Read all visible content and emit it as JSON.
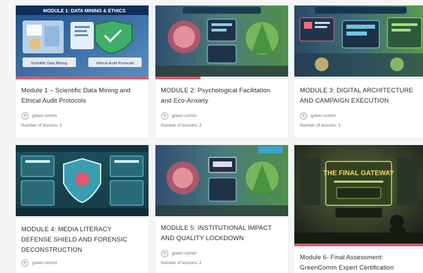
{
  "colors": {
    "accent": "#e2566a",
    "card_bg": "#ffffff",
    "page_bg": "#f4f5f7"
  },
  "courses": [
    {
      "thumb_caption": "MODULE 1: DATA MINING & ETHICS",
      "thumb_left_label": "Scientific Data Mining",
      "thumb_right_label": "Ethical Audit Protocols",
      "title": "Module 1 – Scientific Data Mining and Ethical Audit Protocols",
      "author": "green-comm",
      "lessons": "Number of lessons: 3",
      "progress": 1.0
    },
    {
      "title": "MODULE 2: Psychological Facilitation and Eco-Anxiety",
      "author": "green-comm",
      "lessons": "Number of lessons: 3",
      "progress": 0.34
    },
    {
      "title": "MODULE 3: DIGITAL ARCHITECTURE AND CAMPAIGN EXECUTION",
      "author": "green-comm",
      "lessons": "Number of lessons: 3",
      "progress": 0.0
    },
    {
      "title": "MODULE 4: MEDIA LITERACY DEFENSE SHIELD AND FORENSIC DECONSTRUCTION",
      "author": "green-comm",
      "lessons": "",
      "progress": 0.0
    },
    {
      "title": "MODULE 5: INSTITUTIONAL IMPACT AND QUALITY LOCKDOWN",
      "author": "green-comm",
      "lessons": "Number of lessons: 2",
      "progress": 0.0
    },
    {
      "thumb_caption": "THE FINAL GATEWAY",
      "title": "Module 6- Final Assessment: GreenComm Expert Certification",
      "progress": 1.0
    }
  ]
}
